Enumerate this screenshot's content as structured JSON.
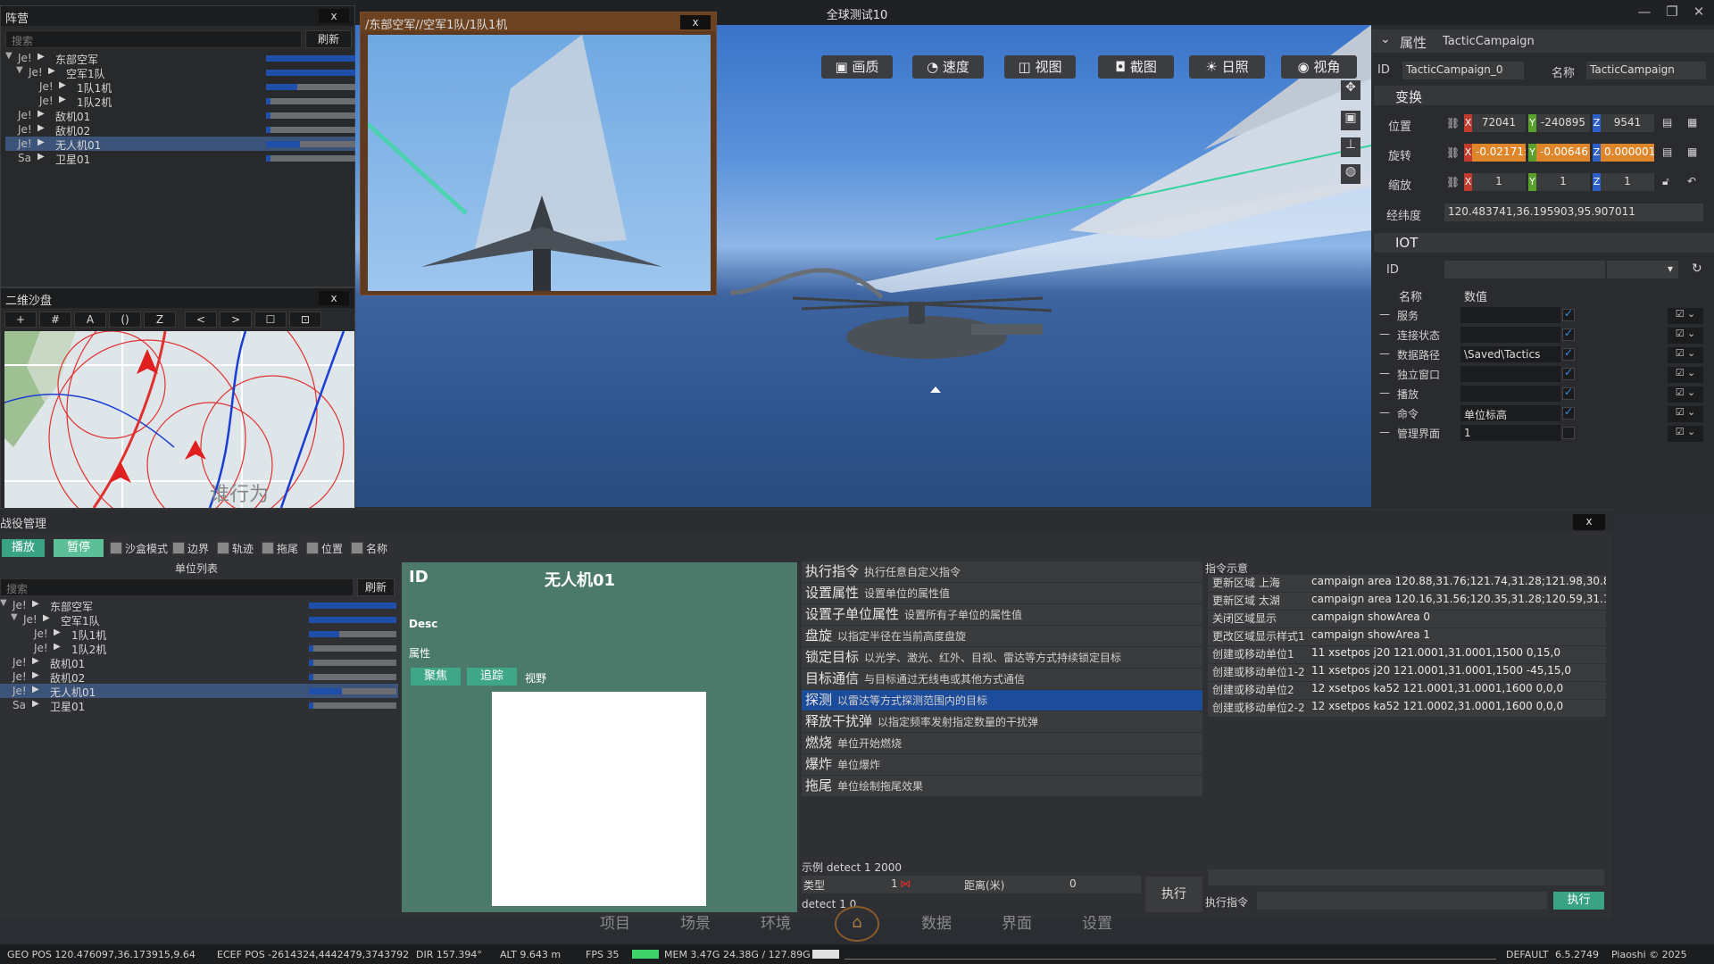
{
  "window": {
    "title": "全球测试10"
  },
  "camp": {
    "title": "阵营",
    "search": "搜索",
    "refresh": "刷新",
    "rows": [
      {
        "tag": "Je!",
        "name": "东部空军",
        "indent": 0,
        "exp": "open",
        "fill": 1.0
      },
      {
        "tag": "Je!",
        "name": "空军1队",
        "indent": 1,
        "exp": "open",
        "fill": 1.0
      },
      {
        "tag": "Je!",
        "name": "1队1机",
        "indent": 2,
        "exp": "none",
        "fill": 0.35
      },
      {
        "tag": "Je!",
        "name": "1队2机",
        "indent": 2,
        "exp": "none",
        "fill": 0.05
      },
      {
        "tag": "Je!",
        "name": "敌机01",
        "indent": 0,
        "exp": "none",
        "fill": 0.05
      },
      {
        "tag": "Je!",
        "name": "敌机02",
        "indent": 0,
        "exp": "none",
        "fill": 0.05
      },
      {
        "tag": "Je!",
        "name": "无人机01",
        "indent": 0,
        "exp": "none",
        "fill": 0.38,
        "sel": true
      },
      {
        "tag": "Sa",
        "name": "卫星01",
        "indent": 0,
        "exp": "none",
        "fill": 0.05
      }
    ]
  },
  "pip": {
    "title": "/东部空军//空军1队/1队1机",
    "close": "x"
  },
  "sandbox": {
    "title": "二维沙盘",
    "close": "x",
    "tools": [
      "+",
      "#",
      "A",
      "()",
      "Z",
      "<",
      ">",
      "☐",
      "⊡"
    ],
    "map_label": "谁行为"
  },
  "toolbar": [
    {
      "icon": "▣",
      "label": "画质"
    },
    {
      "icon": "◔",
      "label": "速度"
    },
    {
      "icon": "◫",
      "label": "视图"
    },
    {
      "icon": "◘",
      "label": "截图"
    },
    {
      "icon": "☀",
      "label": "日照"
    },
    {
      "icon": "◉",
      "label": "视角"
    }
  ],
  "props": {
    "title": "属性",
    "class": "TacticCampaign",
    "id_label": "ID",
    "id_value": "TacticCampaign_0",
    "name_label": "名称",
    "name_value": "TacticCampaign",
    "transform": {
      "title": "变换",
      "rows": [
        {
          "label": "位置",
          "x": "72041",
          "y": "-240895",
          "z": "9541"
        },
        {
          "label": "旋转",
          "x": "-0.02171:",
          "y": "-0.00646",
          "z": "0.000001"
        },
        {
          "label": "缩放",
          "x": "1",
          "y": "1",
          "z": "1"
        }
      ],
      "lonlat_label": "经纬度",
      "lonlat": "120.483741,36.195903,95.907011"
    },
    "iot": {
      "title": "IOT",
      "id_label": "ID",
      "col_name": "名称",
      "col_value": "数值",
      "rows": [
        {
          "name": "服务",
          "value": ""
        },
        {
          "name": "连接状态",
          "value": ""
        },
        {
          "name": "数据路径",
          "value": "\\Saved\\Tactics"
        },
        {
          "name": "独立窗口",
          "value": ""
        },
        {
          "name": "播放",
          "value": ""
        },
        {
          "name": "命令",
          "value": "单位标高"
        },
        {
          "name": "管理界面",
          "value": "1"
        }
      ]
    }
  },
  "battle": {
    "title": "战役管理",
    "close": "x",
    "play": "播放",
    "pause": "暂停",
    "options": [
      "沙盒模式",
      "边界",
      "轨迹",
      "拖尾",
      "位置",
      "名称"
    ],
    "unit_list_title": "单位列表",
    "search": "搜索",
    "refresh": "刷新",
    "rows": [
      {
        "tag": "Je!",
        "name": "东部空军",
        "indent": 0,
        "exp": "open",
        "fill": 1.0
      },
      {
        "tag": "Je!",
        "name": "空军1队",
        "indent": 1,
        "exp": "open",
        "fill": 1.0
      },
      {
        "tag": "Je!",
        "name": "1队1机",
        "indent": 2,
        "exp": "none",
        "fill": 0.35
      },
      {
        "tag": "Je!",
        "name": "1队2机",
        "indent": 2,
        "exp": "none",
        "fill": 0.05
      },
      {
        "tag": "Je!",
        "name": "敌机01",
        "indent": 0,
        "exp": "none",
        "fill": 0.05
      },
      {
        "tag": "Je!",
        "name": "敌机02",
        "indent": 0,
        "exp": "none",
        "fill": 0.05
      },
      {
        "tag": "Je!",
        "name": "无人机01",
        "indent": 0,
        "exp": "none",
        "fill": 0.38,
        "sel": true
      },
      {
        "tag": "Sa",
        "name": "卫星01",
        "indent": 0,
        "exp": "none",
        "fill": 0.05
      }
    ],
    "detail": {
      "id_label": "ID",
      "unit_name": "无人机01",
      "desc": "Desc",
      "attr": "属性",
      "focus": "聚焦",
      "track": "追踪",
      "view": "视野"
    },
    "commands": [
      {
        "name": "执行指令",
        "desc": "执行任意自定义指令"
      },
      {
        "name": "设置属性",
        "desc": "设置单位的属性值"
      },
      {
        "name": "设置子单位属性",
        "desc": "设置所有子单位的属性值"
      },
      {
        "name": "盘旋",
        "desc": "以指定半径在当前高度盘旋"
      },
      {
        "name": "锁定目标",
        "desc": "以光学、激光、红外、目视、雷达等方式持续锁定目标"
      },
      {
        "name": "目标通信",
        "desc": "与目标通过无线电或其他方式通信"
      },
      {
        "name": "探测",
        "desc": "以雷达等方式探测范围内的目标",
        "sel": true
      },
      {
        "name": "释放干扰弹",
        "desc": "以指定频率发射指定数量的干扰弹"
      },
      {
        "name": "燃烧",
        "desc": "单位开始燃烧"
      },
      {
        "name": "爆炸",
        "desc": "单位爆炸"
      },
      {
        "name": "拖尾",
        "desc": "单位绘制拖尾效果"
      }
    ],
    "example": "示例 detect 1 2000",
    "param_type_label": "类型",
    "param_type_value": "1",
    "param_dist_label": "距离(米)",
    "param_dist_value": "0",
    "cmd_preview": "detect 1 0",
    "exec": "执行",
    "hint_title": "指令示意",
    "hints": [
      {
        "a": "更新区域 上海",
        "b": "campaign area 120.88,31.76;121.74,31.28;121.98,30.89;12"
      },
      {
        "a": "更新区域 太湖",
        "b": "campaign area 120.16,31.56;120.35,31.28;120.59,31.17;12"
      },
      {
        "a": "关闭区域显示",
        "b": "campaign showArea 0"
      },
      {
        "a": "更改区域显示样式1",
        "b": "campaign showArea 1"
      },
      {
        "a": "创建或移动单位1",
        "b": "11 xsetpos j20 121.0001,31.0001,1500 0,15,0"
      },
      {
        "a": "创建或移动单位1-2",
        "b": "11 xsetpos j20 121.0001,31.0001,1500 -45,15,0"
      },
      {
        "a": "创建或移动单位2",
        "b": "12 xsetpos ka52 121.0001,31.0001,1600 0,0,0"
      },
      {
        "a": "创建或移动单位2-2",
        "b": "12 xsetpos ka52 121.0002,31.0001,1600 0,0,0"
      }
    ],
    "exec_cmd_label": "执行指令",
    "exec_btn": "执行"
  },
  "bottom_nav": [
    "项目",
    "场景",
    "环境",
    "",
    "数据",
    "界面",
    "设置"
  ],
  "status": {
    "geo": "GEO POS  120.476097,36.173915,9.64",
    "ecef": "ECEF POS  -2614324,4442479,3743792",
    "dir": "DIR  157.394°",
    "alt": "ALT  9.643 m",
    "fps": "FPS  35",
    "mem": "MEM  3.47G  24.38G / 127.89G",
    "default": "DEFAULT",
    "version": "6.5.2749",
    "copyright": "Piaoshi © 2025"
  }
}
